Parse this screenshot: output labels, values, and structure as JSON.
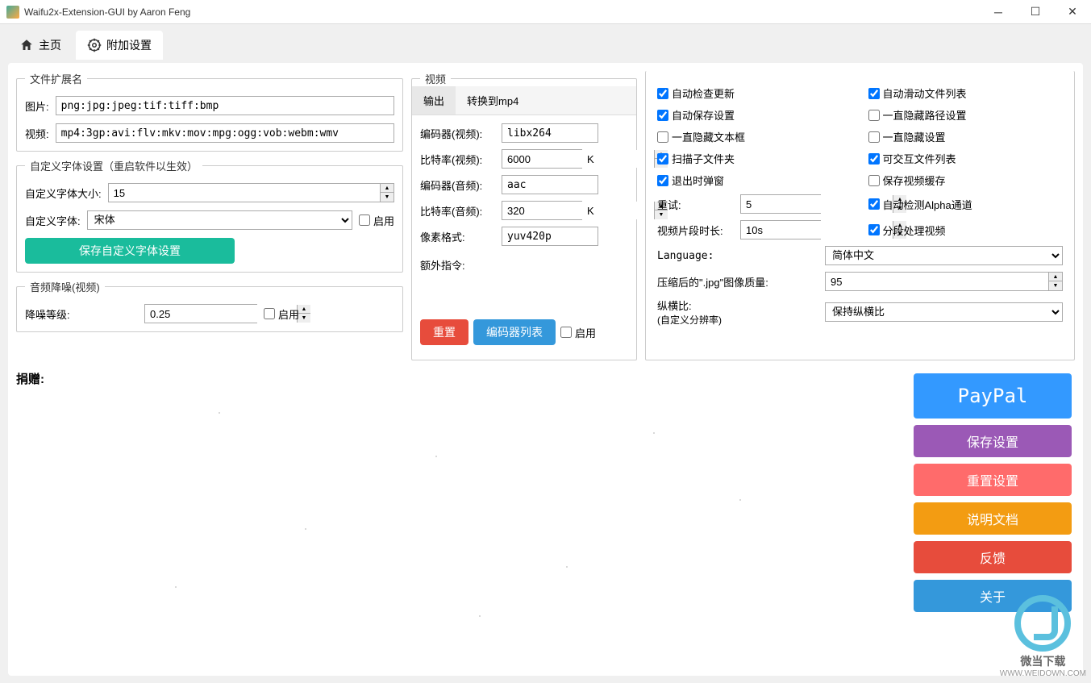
{
  "title": "Waifu2x-Extension-GUI by Aaron Feng",
  "tabs": {
    "home": "主页",
    "extra": "附加设置"
  },
  "ext": {
    "legend": "文件扩展名",
    "img_label": "图片:",
    "img_value": "png:jpg:jpeg:tif:tiff:bmp",
    "vid_label": "视频:",
    "vid_value": "mp4:3gp:avi:flv:mkv:mov:mpg:ogg:vob:webm:wmv"
  },
  "font": {
    "legend": "自定义字体设置（重启软件以生效）",
    "size_label": "自定义字体大小:",
    "size_value": "15",
    "font_label": "自定义字体:",
    "font_value": "宋体",
    "enable": "启用",
    "save_btn": "保存自定义字体设置"
  },
  "denoise": {
    "legend": "音频降噪(视频)",
    "level_label": "降噪等级:",
    "level_value": "0.25",
    "enable": "启用"
  },
  "video": {
    "legend": "视频",
    "subtab_output": "输出",
    "subtab_convert": "转换到mp4",
    "vcodec_label": "编码器(视频):",
    "vcodec_value": "libx264",
    "vbitrate_label": "比特率(视频):",
    "vbitrate_value": "6000",
    "acodec_label": "编码器(音频):",
    "acodec_value": "aac",
    "abitrate_label": "比特率(音频):",
    "abitrate_value": "320",
    "pixfmt_label": "像素格式:",
    "pixfmt_value": "yuv420p",
    "extra_label": "额外指令:",
    "unit_k": "K",
    "reset_btn": "重置",
    "encoder_list_btn": "编码器列表",
    "enable": "启用"
  },
  "opts": {
    "auto_update": "自动检查更新",
    "auto_save": "自动保存设置",
    "hide_textbox": "一直隐藏文本框",
    "scan_subdirs": "扫描子文件夹",
    "popup_exit": "退出时弹窗",
    "auto_scroll": "自动滑动文件列表",
    "hide_path": "一直隐藏路径设置",
    "hide_settings": "一直隐藏设置",
    "interactive_list": "可交互文件列表",
    "save_video_cache": "保存视频缓存",
    "auto_alpha": "自动检测Alpha通道",
    "segment_video": "分段处理视频",
    "retry_label": "重试:",
    "retry_value": "5",
    "segment_label": "视频片段时长:",
    "segment_value": "10s",
    "language_label": "Language:",
    "language_value": "简体中文",
    "jpg_quality_label": "压缩后的\".jpg\"图像质量:",
    "jpg_quality_value": "95",
    "aspect_label": "纵横比:",
    "aspect_sub": "(自定义分辨率)",
    "aspect_value": "保持纵横比"
  },
  "donate": {
    "label": "捐赠:",
    "paypal": "PayPal",
    "save_settings": "保存设置",
    "reset_settings": "重置设置",
    "docs": "说明文档",
    "feedback": "反馈",
    "about": "关于"
  },
  "watermark": {
    "line1": "微当下载",
    "line2": "WWW.WEIDOWN.COM"
  }
}
